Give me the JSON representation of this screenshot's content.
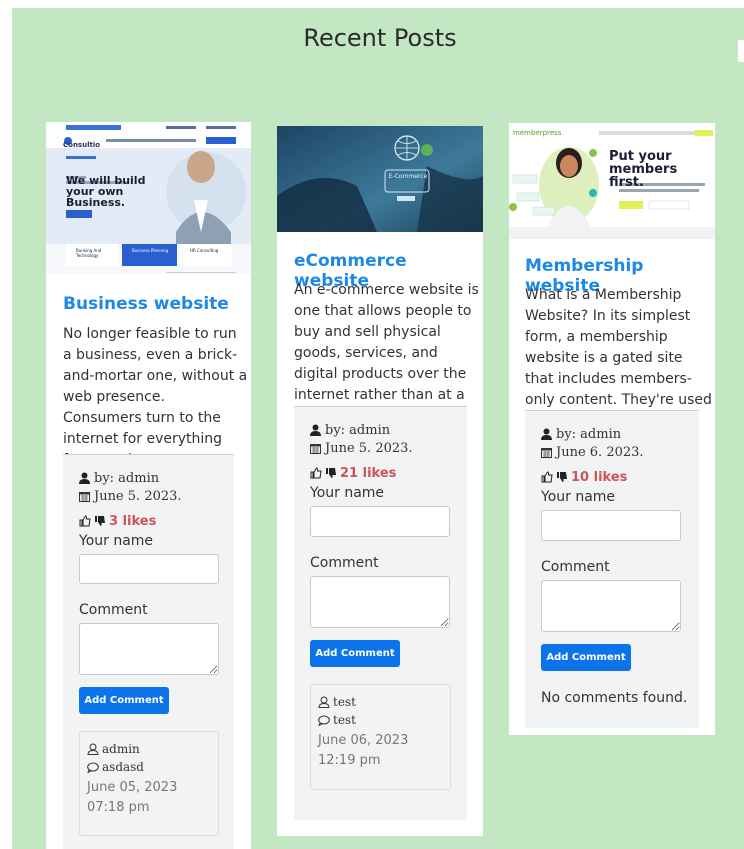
{
  "page": {
    "heading": "Recent Posts"
  },
  "labels": {
    "your_name": "Your name",
    "comment": "Comment",
    "add_comment": "Add Comment"
  },
  "posts": [
    {
      "title": "Business website",
      "excerpt": "No longer feasible to run a business, even a brick-and-mortar one, without a web presence. Consumers turn to the internet for everything from product ...",
      "author": "by: admin",
      "date": "June 5. 2023.",
      "likes": "3 likes",
      "thumbnail": {
        "brand": "Consultio",
        "headline": "We will build your own Business.",
        "feature_1": "Banking And Technology",
        "feature_2": "Business Planning",
        "feature_3": "HR Consulting"
      },
      "comment": {
        "user": "admin",
        "text": "asdasd",
        "date": "June 05, 2023 07:18 pm"
      }
    },
    {
      "title": "eCommerce website",
      "excerpt": "An e-commerce website is one that allows people to buy and sell physical goods, services, and digital products over the internet rather than at a bric...",
      "author": "by: admin",
      "date": "June 5. 2023.",
      "likes": "21 likes",
      "thumbnail": {
        "caption": "E-Commerce"
      },
      "comment": {
        "user": "test",
        "text": "test",
        "date": "June 06, 2023 12:19 pm"
      }
    },
    {
      "title": "Membership website",
      "excerpt": "What is a Membership Website? In its simplest form, a membership website is a gated site that includes members-only content. They're used by nonprofit...",
      "author": "by: admin",
      "date": "June 6. 2023.",
      "likes": "10 likes",
      "thumbnail": {
        "brand": "memberpress",
        "headline": "Put your members first."
      },
      "no_comments": "No comments found."
    }
  ],
  "colors": {
    "background": "#c3e6c3",
    "link": "#1e88e5",
    "likes": "#cc5555",
    "button": "#0d73ea"
  }
}
